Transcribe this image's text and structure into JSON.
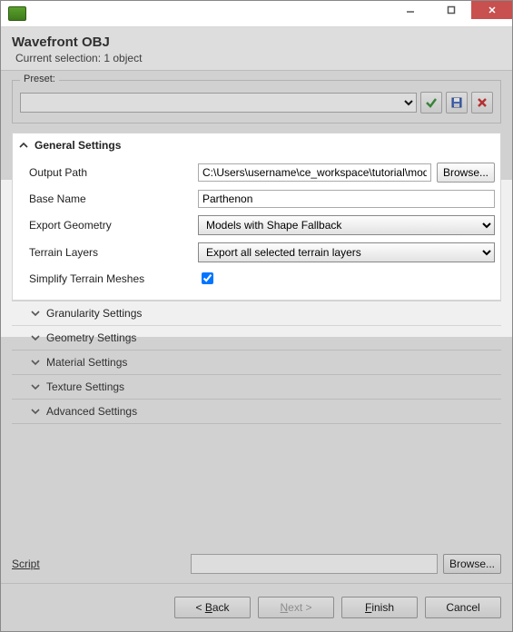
{
  "window": {
    "title": "Wavefront OBJ",
    "subtitle": "Current selection: 1 object"
  },
  "preset": {
    "label": "Preset:",
    "value": "",
    "apply_tip": "Apply",
    "save_tip": "Save",
    "delete_tip": "Delete"
  },
  "general": {
    "title": "General Settings",
    "output_path_label": "Output Path",
    "output_path_value": "C:\\Users\\username\\ce_workspace\\tutorial\\models",
    "browse_label": "Browse...",
    "base_name_label": "Base Name",
    "base_name_value": "Parthenon",
    "export_geometry_label": "Export Geometry",
    "export_geometry_value": "Models with Shape Fallback",
    "terrain_layers_label": "Terrain Layers",
    "terrain_layers_value": "Export all selected terrain layers",
    "simplify_label": "Simplify Terrain Meshes",
    "simplify_checked": true
  },
  "collapsed_sections": [
    "Granularity Settings",
    "Geometry Settings",
    "Material Settings",
    "Texture Settings",
    "Advanced Settings"
  ],
  "script": {
    "label": "Script",
    "value": "",
    "browse_label": "Browse..."
  },
  "footer": {
    "back": "< Back",
    "next": "Next >",
    "finish": "Finish",
    "cancel": "Cancel"
  }
}
